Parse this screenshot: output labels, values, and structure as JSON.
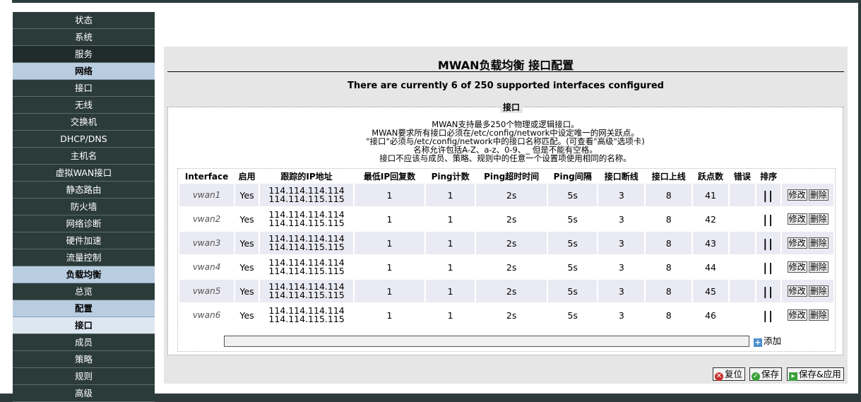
{
  "sidebar": {
    "items": [
      {
        "label": "状态",
        "type": "item"
      },
      {
        "label": "系统",
        "type": "item"
      },
      {
        "label": "服务",
        "type": "dark"
      },
      {
        "label": "网络",
        "type": "header"
      },
      {
        "label": "接口",
        "type": "item"
      },
      {
        "label": "无线",
        "type": "item"
      },
      {
        "label": "交换机",
        "type": "item"
      },
      {
        "label": "DHCP/DNS",
        "type": "item"
      },
      {
        "label": "主机名",
        "type": "item"
      },
      {
        "label": "虚拟WAN接口",
        "type": "item"
      },
      {
        "label": "静态路由",
        "type": "item"
      },
      {
        "label": "防火墙",
        "type": "item"
      },
      {
        "label": "网络诊断",
        "type": "item"
      },
      {
        "label": "硬件加速",
        "type": "item"
      },
      {
        "label": "流量控制",
        "type": "item"
      },
      {
        "label": "负载均衡",
        "type": "header"
      },
      {
        "label": "总览",
        "type": "item"
      },
      {
        "label": "配置",
        "type": "header"
      },
      {
        "label": "接口",
        "type": "active-sub"
      },
      {
        "label": "成员",
        "type": "item"
      },
      {
        "label": "策略",
        "type": "item"
      },
      {
        "label": "规则",
        "type": "item"
      },
      {
        "label": "高级",
        "type": "item"
      }
    ]
  },
  "main": {
    "title": "MWAN负载均衡 接口配置",
    "subtitle": "There are currently 6 of 250 supported interfaces configured",
    "legend": "接口",
    "description": [
      "MWAN支持最多250个物理或逻辑接口。",
      "MWAN要求所有接口必须在/etc/config/network中设定唯一的网关跃点。",
      "\"接口\"必须与/etc/config/network中的接口名称匹配。(可查看\"高级\"选项卡)",
      "名称允许包括A-Z、a-z、0-9、_ 但是不能有空格。",
      "接口不应该与成员、策略、规则中的任意一个设置项使用相同的名称。"
    ],
    "columns": [
      "Interface",
      "启用",
      "跟踪的IP地址",
      "最低IP回复数",
      "Ping计数",
      "Ping超时时间",
      "Ping间隔",
      "接口断线",
      "接口上线",
      "跃点数",
      "错误",
      "排序",
      ""
    ],
    "rows": [
      {
        "name": "vwan1",
        "enabled": "Yes",
        "ip1": "114.114.114.114",
        "ip2": "114.114.115.115",
        "min_reply": "1",
        "ping_count": "1",
        "ping_timeout": "2s",
        "ping_interval": "5s",
        "down": "3",
        "up": "8",
        "metric": "41",
        "error": ""
      },
      {
        "name": "vwan2",
        "enabled": "Yes",
        "ip1": "114.114.114.114",
        "ip2": "114.114.115.115",
        "min_reply": "1",
        "ping_count": "1",
        "ping_timeout": "2s",
        "ping_interval": "5s",
        "down": "3",
        "up": "8",
        "metric": "42",
        "error": ""
      },
      {
        "name": "vwan3",
        "enabled": "Yes",
        "ip1": "114.114.114.114",
        "ip2": "114.114.115.115",
        "min_reply": "1",
        "ping_count": "1",
        "ping_timeout": "2s",
        "ping_interval": "5s",
        "down": "3",
        "up": "8",
        "metric": "43",
        "error": ""
      },
      {
        "name": "vwan4",
        "enabled": "Yes",
        "ip1": "114.114.114.114",
        "ip2": "114.114.115.115",
        "min_reply": "1",
        "ping_count": "1",
        "ping_timeout": "2s",
        "ping_interval": "5s",
        "down": "3",
        "up": "8",
        "metric": "44",
        "error": ""
      },
      {
        "name": "vwan5",
        "enabled": "Yes",
        "ip1": "114.114.114.114",
        "ip2": "114.114.115.115",
        "min_reply": "1",
        "ping_count": "1",
        "ping_timeout": "2s",
        "ping_interval": "5s",
        "down": "3",
        "up": "8",
        "metric": "45",
        "error": ""
      },
      {
        "name": "vwan6",
        "enabled": "Yes",
        "ip1": "114.114.114.114",
        "ip2": "114.114.115.115",
        "min_reply": "1",
        "ping_count": "1",
        "ping_timeout": "2s",
        "ping_interval": "5s",
        "down": "3",
        "up": "8",
        "metric": "46",
        "error": ""
      }
    ],
    "sort_glyph": "||",
    "edit_label": "修改",
    "delete_label": "删除",
    "add_label": "添加",
    "add_value": ""
  },
  "actions": {
    "reset_label": "复位",
    "save_label": "保存",
    "save_apply_label": "保存&应用"
  }
}
